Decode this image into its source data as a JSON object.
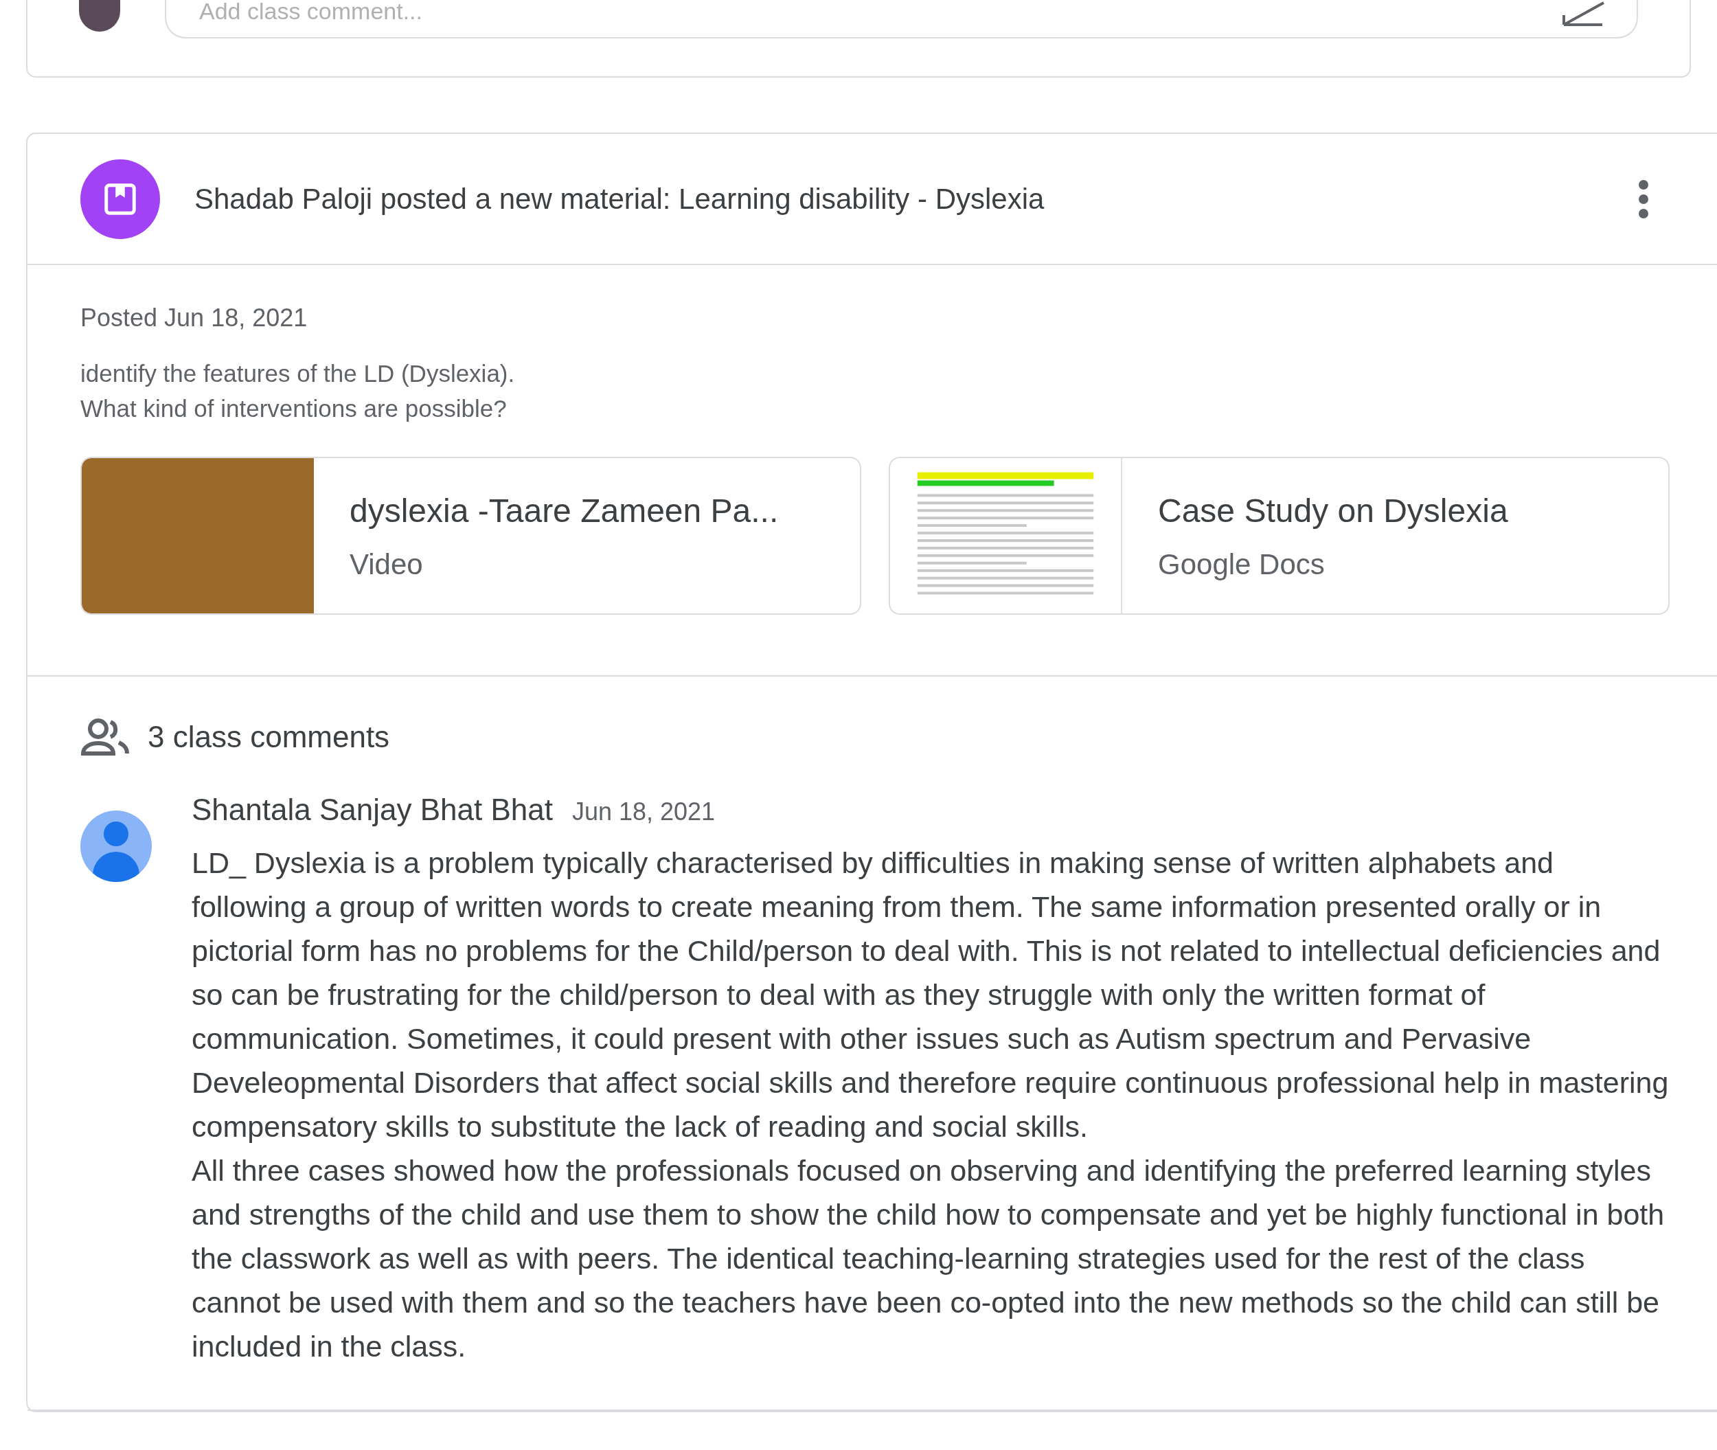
{
  "comment_box": {
    "placeholder": "Add class comment..."
  },
  "post": {
    "title": "Shadab Paloji posted a new material: Learning disability - Dyslexia",
    "posted": "Posted Jun 18, 2021",
    "description": [
      "identify the features of the LD (Dyslexia).",
      "What kind of interventions are possible?"
    ],
    "attachments": [
      {
        "kind": "video",
        "title": "dyslexia -Taare Zameen Pa...",
        "type": "Video"
      },
      {
        "kind": "doc",
        "title": "Case Study on Dyslexia",
        "type": "Google Docs"
      }
    ],
    "comments_count": "3 class comments",
    "comments": [
      {
        "author": "Shantala Sanjay Bhat Bhat",
        "date": "Jun 18, 2021",
        "paragraphs": [
          "LD_ Dyslexia is a problem typically characterised by difficulties in making sense of written alphabets and following a group of written words to create meaning from them. The same information presented orally or in pictorial form has no problems for the Child/person to deal with. This is not related to intellectual deficiencies and so can be frustrating for the child/person to deal with as they struggle with only the written format of communication. Sometimes, it could present with other issues such as Autism spectrum and Pervasive Develeopmental Disorders that affect social skills and therefore require continuous professional help in mastering compensatory skills to substitute the lack of reading and social skills.",
          "All three cases showed how the professionals focused on observing and identifying the preferred learning styles and strengths of the child and use them to show the child how to compensate and yet be highly functional in both the classwork as well as with peers. The identical teaching-learning strategies used for the rest of the class cannot be used with them and so the teachers have been co-opted into the new methods so the child can still be included in the class."
        ]
      }
    ]
  }
}
